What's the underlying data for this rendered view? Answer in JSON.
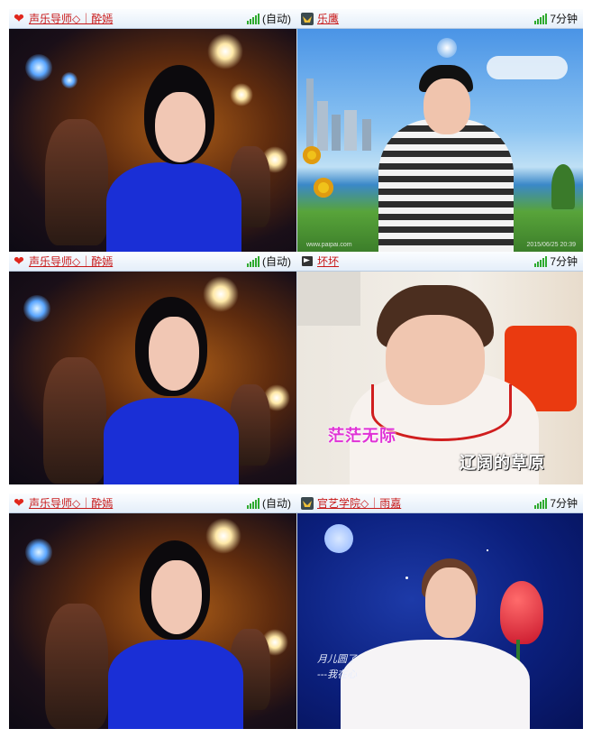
{
  "rows": [
    {
      "left": {
        "name": "声乐导师◇｜酔嫣",
        "status": "(自动)",
        "icon": "heart-icon"
      },
      "right": {
        "name": "乐鹰",
        "status": "7分钟",
        "icon": "yellow-bird-icon"
      }
    },
    {
      "left": {
        "name": "声乐导师◇｜酔嫣",
        "status": "(自动)",
        "icon": "heart-icon"
      },
      "right": {
        "name": "坏坏",
        "status": "7分钟",
        "icon": "black-flag-icon",
        "subtitle_1": "茫茫无际",
        "subtitle_2": "辽阔的草原"
      }
    },
    {
      "left": {
        "name": "声乐导师◇｜酔嫣",
        "status": "(自动)",
        "icon": "heart-icon"
      },
      "right": {
        "name": "官艺学院◇｜雨嘉",
        "status": "7分钟",
        "icon": "yellow-bird-icon",
        "poem_1": "月儿圆了",
        "poem_2": "---我在心"
      }
    }
  ],
  "colors": {
    "name_link": "#c81818",
    "signal": "#2eaa2e",
    "subtitle_pink": "#e032d6",
    "subtitle_white": "#ffffff",
    "title_bar": "#e4eef9"
  }
}
